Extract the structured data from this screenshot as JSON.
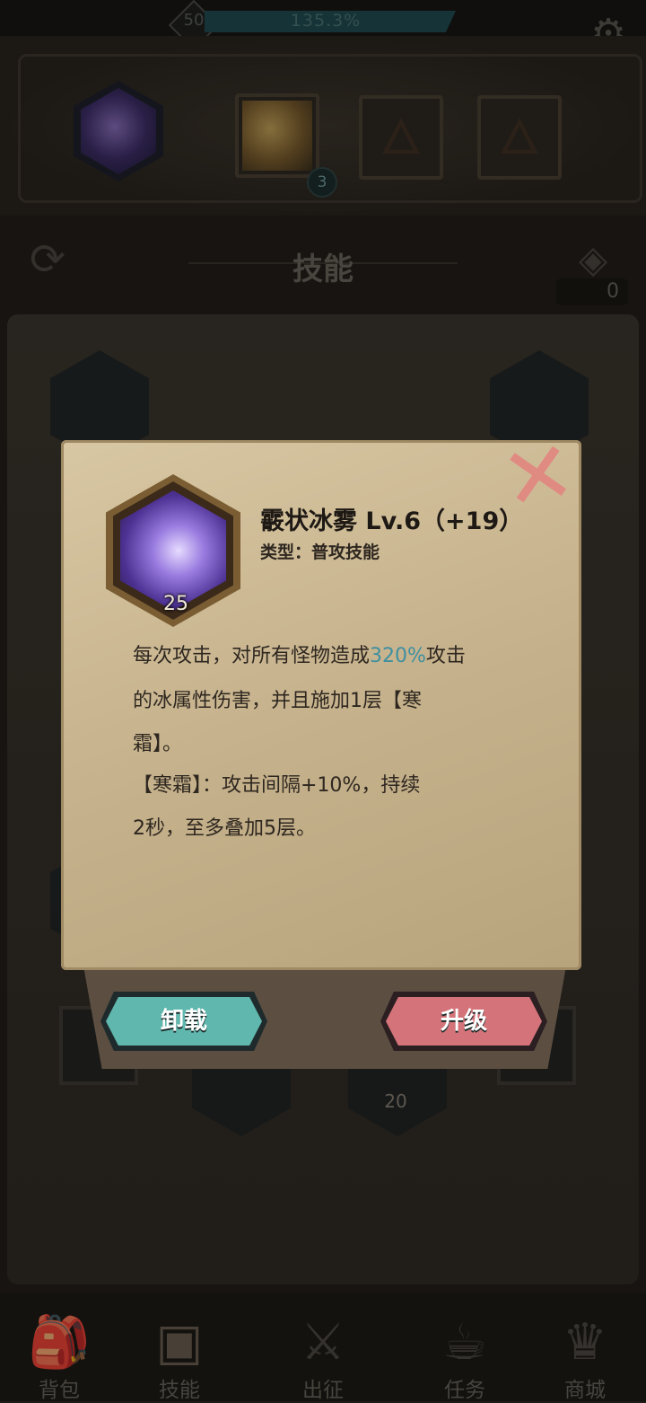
{
  "top": {
    "player_level": "50",
    "xp_percent_text": "135.3%",
    "xp_fraction": 1.0
  },
  "equipped": {
    "slot2_count": "3"
  },
  "header": {
    "title": "技能",
    "gem_count": "0"
  },
  "background": {
    "bottom_count": "20"
  },
  "modal": {
    "skill_level_badge": "25",
    "skill_name": "霰状冰雾  Lv.6（+19）",
    "skill_type": "类型：普攻技能",
    "desc_line1_pre": "每次攻击，对所有怪物造成",
    "desc_line1_hl": "320%",
    "desc_line1_post": "攻击",
    "desc_line2": "的冰属性伤害，并且施加1层【寒",
    "desc_line3": "霜】。",
    "desc_line4": "【寒霜】：攻击间隔+10%，持续",
    "desc_line5": "2秒，至多叠加5层。",
    "unequip_label": "卸载",
    "upgrade_label": "升级"
  },
  "nav": [
    {
      "label": "背包",
      "icon": "bag-icon"
    },
    {
      "label": "技能",
      "icon": "skill-book-icon"
    },
    {
      "label": "出征",
      "icon": "sword-icon"
    },
    {
      "label": "任务",
      "icon": "quest-icon"
    },
    {
      "label": "商城",
      "icon": "shop-icon"
    }
  ]
}
